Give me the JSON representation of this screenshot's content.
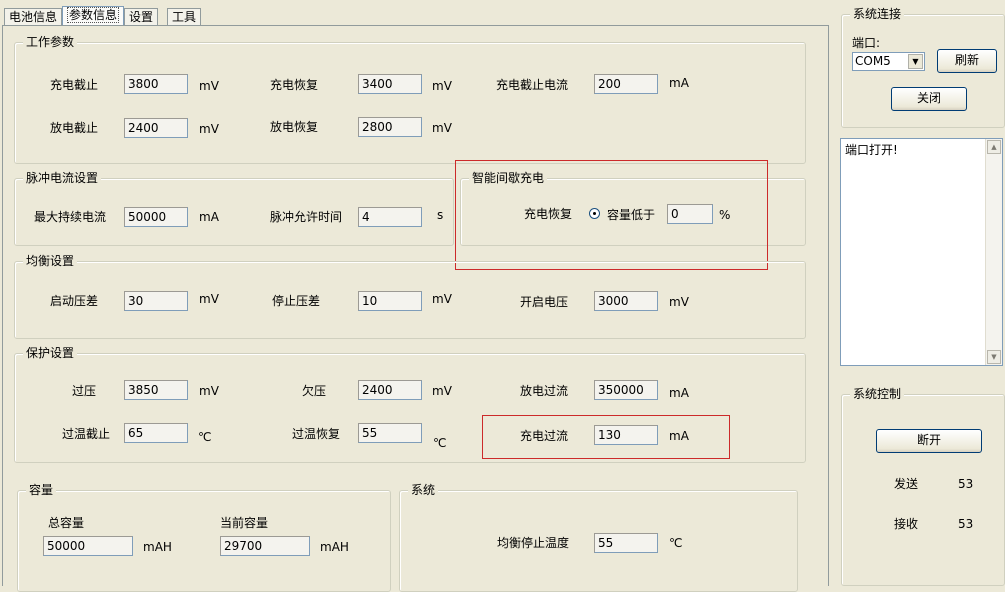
{
  "tabs": [
    "电池信息",
    "参数信息",
    "设置",
    "工具"
  ],
  "work_params": {
    "title": "工作参数",
    "charge_cutoff_label": "充电截止",
    "charge_cutoff_value": "3800",
    "charge_cutoff_unit": "mV",
    "charge_recover_label": "充电恢复",
    "charge_recover_value": "3400",
    "charge_recover_unit": "mV",
    "charge_cutoff_current_label": "充电截止电流",
    "charge_cutoff_current_value": "200",
    "charge_cutoff_current_unit": "mA",
    "discharge_cutoff_label": "放电截止",
    "discharge_cutoff_value": "2400",
    "discharge_cutoff_unit": "mV",
    "discharge_recover_label": "放电恢复",
    "discharge_recover_value": "2800",
    "discharge_recover_unit": "mV"
  },
  "pulse": {
    "title": "脉冲电流设置",
    "max_current_label": "最大持续电流",
    "max_current_value": "50000",
    "max_current_unit": "mA",
    "pulse_time_label": "脉冲允许时间",
    "pulse_time_value": "4",
    "pulse_time_unit": "s"
  },
  "smart_charge": {
    "title": "智能间歇充电",
    "recover_label": "充电恢复",
    "option_label": "容量低于",
    "value": "0",
    "unit": "%"
  },
  "balance": {
    "title": "均衡设置",
    "start_diff_label": "启动压差",
    "start_diff_value": "30",
    "start_diff_unit": "mV",
    "stop_diff_label": "停止压差",
    "stop_diff_value": "10",
    "stop_diff_unit": "mV",
    "open_voltage_label": "开启电压",
    "open_voltage_value": "3000",
    "open_voltage_unit": "mV"
  },
  "protect": {
    "title": "保护设置",
    "over_voltage_label": "过压",
    "over_voltage_value": "3850",
    "over_voltage_unit": "mV",
    "under_voltage_label": "欠压",
    "under_voltage_value": "2400",
    "under_voltage_unit": "mV",
    "discharge_over_current_label": "放电过流",
    "discharge_over_current_value": "350000",
    "discharge_over_current_unit": "mA",
    "over_temp_cutoff_label": "过温截止",
    "over_temp_cutoff_value": "65",
    "over_temp_cutoff_unit": "℃",
    "over_temp_recover_label": "过温恢复",
    "over_temp_recover_value": "55",
    "over_temp_recover_unit": "℃",
    "charge_over_current_label": "充电过流",
    "charge_over_current_value": "130",
    "charge_over_current_unit": "mA"
  },
  "capacity": {
    "title": "容量",
    "total_label": "总容量",
    "total_value": "50000",
    "total_unit": "mAH",
    "current_label": "当前容量",
    "current_value": "29700",
    "current_unit": "mAH"
  },
  "system": {
    "title": "系统",
    "balance_stop_temp_label": "均衡停止温度",
    "balance_stop_temp_value": "55",
    "balance_stop_temp_unit": "℃"
  },
  "connection": {
    "title": "系统连接",
    "port_label": "端口:",
    "port_value": "COM5",
    "refresh_label": "刷新",
    "close_label": "关闭"
  },
  "log": {
    "text": "端口打开!"
  },
  "control": {
    "title": "系统控制",
    "disconnect_label": "断开",
    "send_label": "发送",
    "send_value": "53",
    "receive_label": "接收",
    "receive_value": "53"
  },
  "colors": {
    "background": "#ece9d8",
    "highlight_border": "#cc2a2a",
    "input_border": "#7f9db9"
  }
}
